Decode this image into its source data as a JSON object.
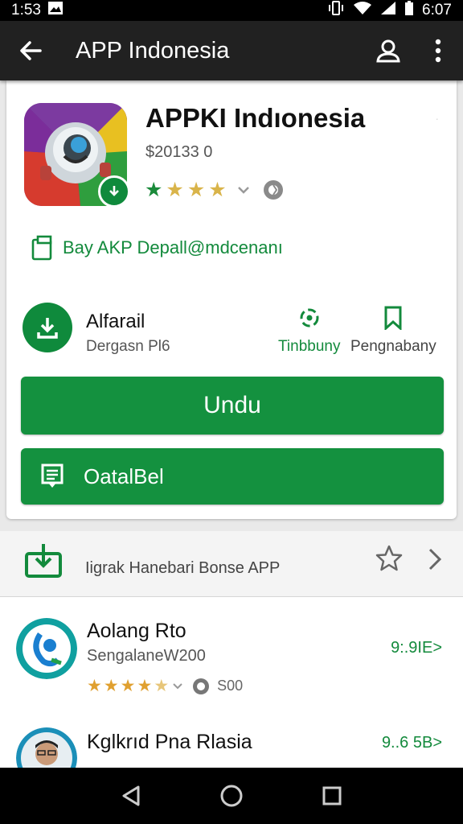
{
  "status_bar": {
    "time": "1:53",
    "clock": "6:07"
  },
  "toolbar": {
    "title": "APP Indonesia"
  },
  "app": {
    "name": "APPKI Indıonesia",
    "subtitle": "$20133 0",
    "rating_stars": 4
  },
  "buy_link": {
    "label": "Bay AKP Depall@mdcenanı"
  },
  "install": {
    "title": "Alfarail",
    "subtitle": "Dergasn Pl6",
    "action1_label": "Tinbbuny",
    "action2_label": "Pengnabany"
  },
  "buttons": {
    "primary_label": "Undu",
    "secondary_label": "OatalBel"
  },
  "section": {
    "label": "Iigrak Hanebari Bonse APP"
  },
  "list": [
    {
      "title": "Aolang Rto",
      "subtitle": "SengalaneW200",
      "price": "9:.9ΙΕ>",
      "rating_extra": "S00"
    },
    {
      "title": "Kglkrıd Pna Rlasia",
      "price": "9..6 5Β>"
    }
  ],
  "colors": {
    "accent": "#14913f",
    "toolbar": "#212121",
    "star_green": "#1a8a3a",
    "star_gold": "#d9b44a"
  }
}
